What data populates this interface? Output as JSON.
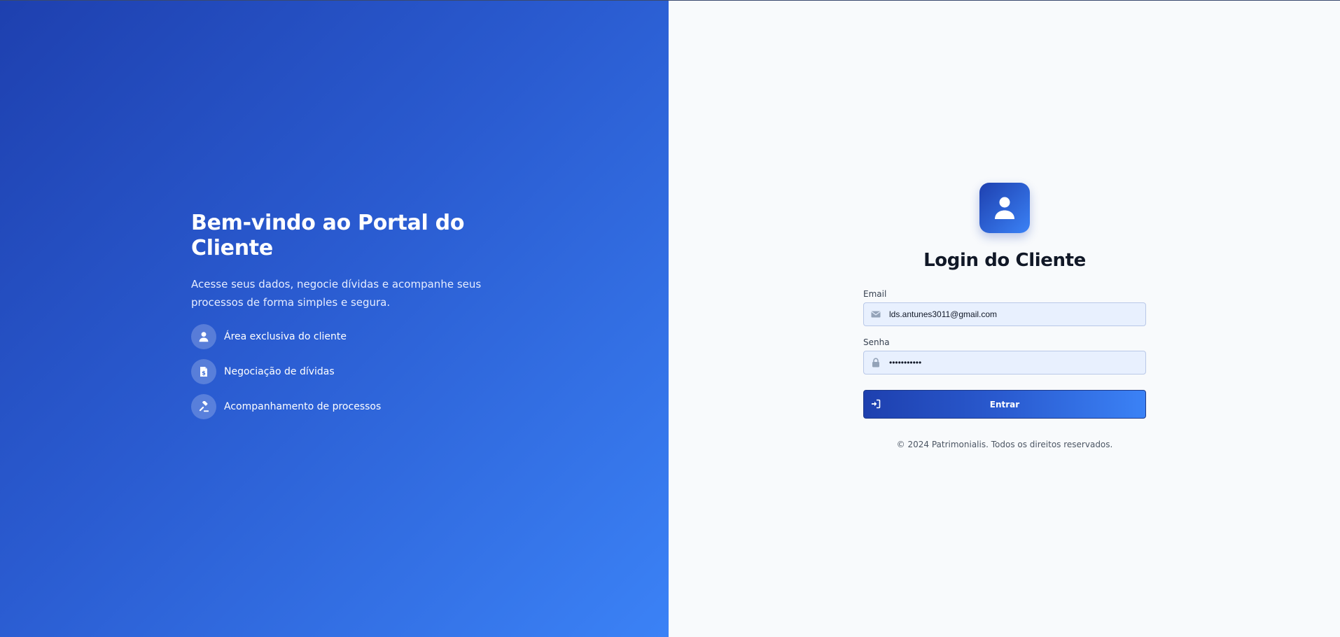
{
  "hero": {
    "title": "Bem-vindo ao Portal do Cliente",
    "subtitle": "Acesse seus dados, negocie dívidas e acompanhe seus processos de forma simples e segura.",
    "features": [
      {
        "icon": "user-icon",
        "label": "Área exclusiva do cliente"
      },
      {
        "icon": "invoice-dollar-icon",
        "label": "Negociação de dívidas"
      },
      {
        "icon": "gavel-icon",
        "label": "Acompanhamento de processos"
      }
    ]
  },
  "login": {
    "logo_icon": "user-icon",
    "title": "Login do Cliente",
    "email": {
      "label": "Email",
      "icon": "envelope-icon",
      "value": "lds.antunes3011@gmail.com"
    },
    "password": {
      "label": "Senha",
      "icon": "lock-icon",
      "value": "•••••••••••"
    },
    "submit": {
      "icon": "sign-in-icon",
      "label": "Entrar"
    },
    "footer": "© 2024 Patrimonialis. Todos os direitos reservados."
  },
  "colors": {
    "brand_dark": "#1e40af",
    "brand_light": "#3b82f6",
    "background_right": "#f8fafc",
    "input_bg": "#e8f0fe",
    "title_text": "#111827"
  }
}
